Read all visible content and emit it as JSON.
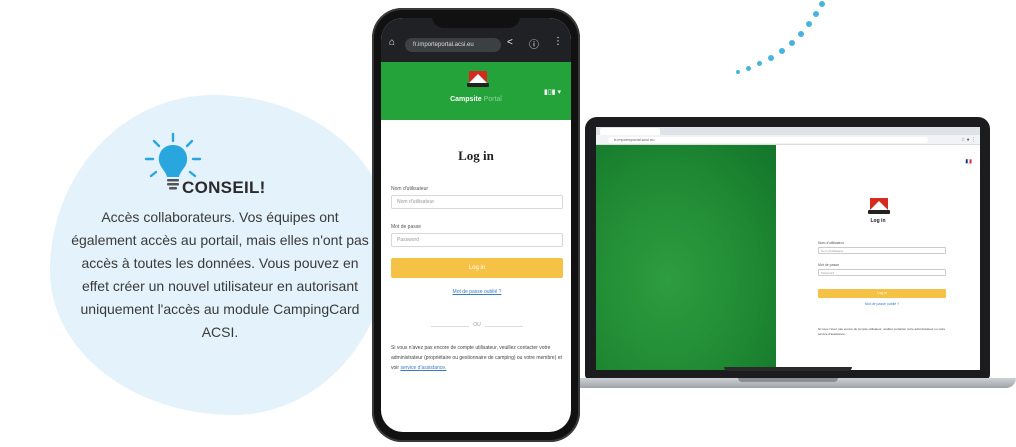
{
  "tip": {
    "title": "CONSEIL!",
    "body": "Accès collaborateurs. Vos équipes ont également accès au portail, mais elles n'ont pas accès à toutes les données. Vous pouvez en effet créer un nouvel utilisateur en autorisant uniquement l'accès au module CampingCard ACSI.",
    "icon": "lightbulb-icon",
    "bulb_color": "#2aa6df",
    "blob_color": "#e3f2fb"
  },
  "phone": {
    "url": "fr.importeportal.acsi.eu",
    "brand_main": "Campsite",
    "brand_accent": "Portal",
    "title": "Log in",
    "username_label": "Nom d'utilisateur",
    "username_placeholder": "Nom d'utilisateur",
    "password_label": "Mot de passe",
    "password_placeholder": "Password",
    "login_button": "Log in",
    "forgot_link": "Mot de passe oublié ?",
    "separator": "OU",
    "note": "Si vous n'avez pas encore de compte utilisateur, veuillez contacter votre administrateur (propriétaire ou gestionnaire de camping) ou votre membre) et voir",
    "note_link": "service d'assistance.",
    "header_color": "#23a33a",
    "button_color": "#f6c245"
  },
  "laptop": {
    "url": "fr.importeportal.acsi.eu",
    "flag": "🇫🇷",
    "title": "Log in",
    "username_label": "Nom d'utilisateur",
    "username_placeholder": "Nom d'utilisateur",
    "password_label": "Mot de passe",
    "password_placeholder": "Password",
    "login_button": "Log in",
    "forgot_link": "Mot de passe oublié ?",
    "note": "Si vous n'avez pas encore de compte utilisateur, veuillez contacter votre administrateur ou votre service d'assistance."
  }
}
